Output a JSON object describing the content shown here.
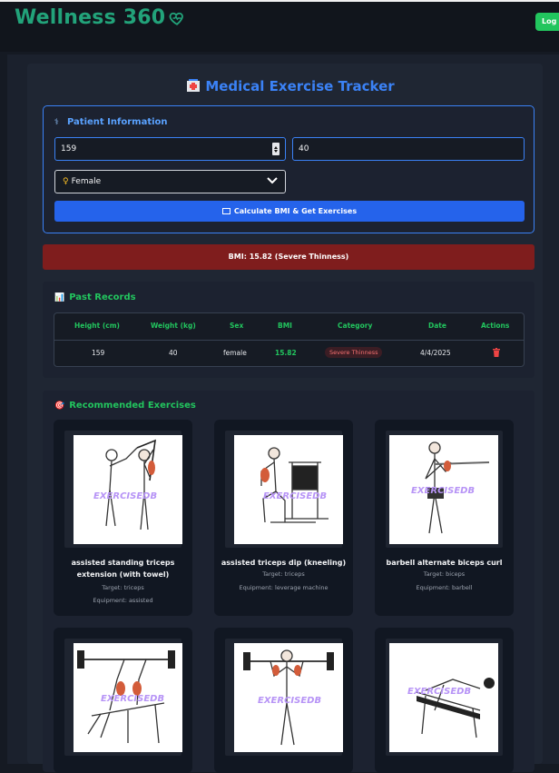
{
  "app": {
    "title": "Wellness 360",
    "logout_label": "Log Out"
  },
  "page": {
    "title": "Medical Exercise Tracker"
  },
  "patient_form": {
    "title": "Patient Information",
    "height_value": "159",
    "weight_value": "40",
    "sex_selected": "Female",
    "calculate_label": "Calculate BMI & Get Exercises"
  },
  "bmi_result": "BMI: 15.82 (Severe Thinness)",
  "past_records": {
    "title": "Past Records",
    "columns": [
      "Height (cm)",
      "Weight (kg)",
      "Sex",
      "BMI",
      "Category",
      "Date",
      "Actions"
    ],
    "rows": [
      {
        "height": "159",
        "weight": "40",
        "sex": "female",
        "bmi": "15.82",
        "category": "Severe Thinness",
        "date": "4/4/2025"
      }
    ]
  },
  "recommended": {
    "title": "Recommended Exercises",
    "exercises": [
      {
        "name": "assisted standing triceps extension (with towel)",
        "target": "Target: triceps",
        "equipment": "Equipment: assisted"
      },
      {
        "name": "assisted triceps dip (kneeling)",
        "target": "Target: triceps",
        "equipment": "Equipment: leverage machine"
      },
      {
        "name": "barbell alternate biceps curl",
        "target": "Target: biceps",
        "equipment": "Equipment: barbell"
      },
      {
        "name": "",
        "target": "",
        "equipment": ""
      },
      {
        "name": "",
        "target": "",
        "equipment": ""
      },
      {
        "name": "",
        "target": "",
        "equipment": ""
      }
    ],
    "watermark": "EXERCISEDB"
  },
  "colors": {
    "accent": "#3b82f6",
    "success": "#22c55e",
    "danger": "#7f1d1d",
    "brand": "#22a37a"
  }
}
